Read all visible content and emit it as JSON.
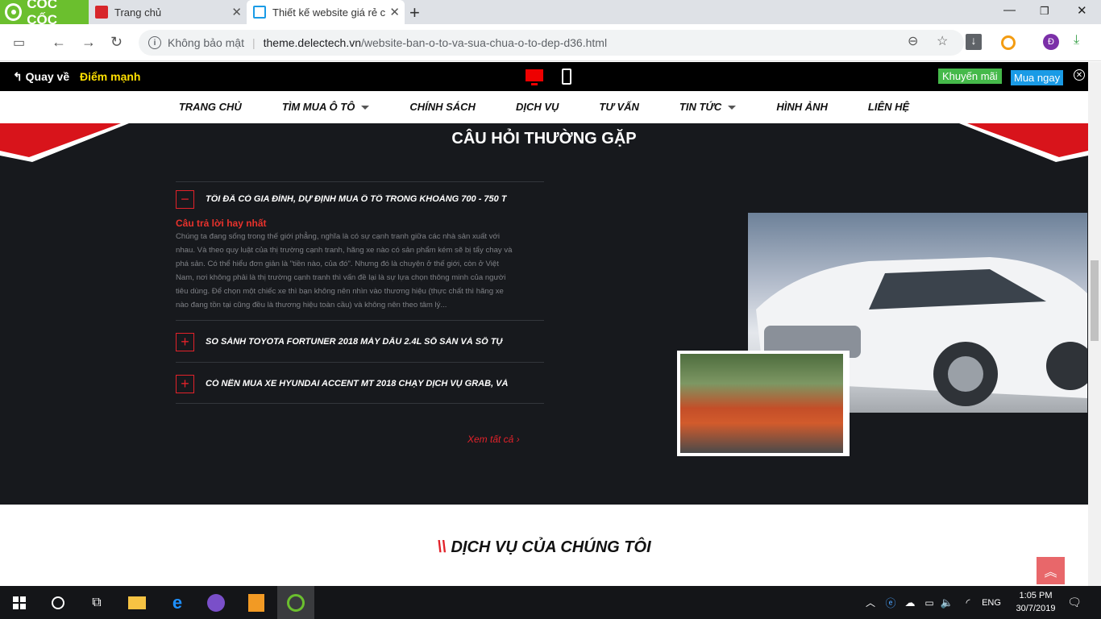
{
  "browser": {
    "brand": "CỐC CỐC",
    "tabs": [
      {
        "title": "Trang chủ"
      },
      {
        "title": "Thiết kế website giá rẻ chỉ"
      }
    ],
    "new_tab": "+",
    "security_label": "Không bảo mật",
    "url_domain": "theme.delectech.vn",
    "url_path": "/website-ban-o-to-va-sua-chua-o-to-dep-d36.html",
    "profile_initial": "Đ"
  },
  "preview_bar": {
    "back_label": "Quay về",
    "highlight_label": "Điểm mạnh",
    "promo_label": "Khuyến mãi",
    "buy_label": "Mua ngay"
  },
  "menu": [
    {
      "label": "TRANG CHỦ",
      "dropdown": false
    },
    {
      "label": "TÌM MUA Ô TÔ",
      "dropdown": true
    },
    {
      "label": "CHÍNH SÁCH",
      "dropdown": false
    },
    {
      "label": "DỊCH VỤ",
      "dropdown": false
    },
    {
      "label": "TƯ VẤN",
      "dropdown": false
    },
    {
      "label": "TIN TỨC",
      "dropdown": true
    },
    {
      "label": "HÌNH ẢNH",
      "dropdown": false
    },
    {
      "label": "LIÊN HỆ",
      "dropdown": false
    }
  ],
  "faq": {
    "title": "CÂU HỎI THƯỜNG GẶP",
    "items": [
      {
        "question": "TÔI ĐÃ CÓ GIA ĐÌNH, DỰ ĐỊNH MUA Ô TÔ TRONG KHOẢNG 700 - 750 T",
        "expanded": true
      },
      {
        "question": "SO SÁNH TOYOTA FORTUNER 2018 MÁY DẦU 2.4L SỐ SÀN VÀ SỐ TỰ",
        "expanded": false
      },
      {
        "question": "CÓ NÊN MUA XE HYUNDAI ACCENT MT 2018 CHẠY DỊCH VỤ GRAB, VÀ",
        "expanded": false
      }
    ],
    "answer_label": "Câu trả lời hay nhất",
    "answer_text": "Chúng ta đang sống trong thế giới phẳng, nghĩa là có sự cạnh tranh giữa các nhà sản xuất với nhau. Và theo quy luật của thị trường cạnh tranh, hãng xe nào có sản phẩm kém sẽ bị tẩy chay và phá sản. Có thể hiểu đơn giản là \"tiền nào, của đó\". Nhưng đó là chuyện ở thế giới, còn ở Việt Nam, nơi không phải là thị trường cạnh tranh thì vấn đề lại là sự lựa chọn thông minh của người tiêu dùng. Để chọn một chiếc xe thì bạn không nên nhìn vào thương hiệu (thực chất thì hãng xe nào đang tồn tại cũng đều là thương hiệu toàn cầu) và không nên theo tâm lý...",
    "view_all": "Xem tất cả ›"
  },
  "services": {
    "title": "DỊCH VỤ CỦA CHÚNG TÔI"
  },
  "taskbar": {
    "language": "ENG",
    "time": "1:05 PM",
    "date": "30/7/2019"
  }
}
